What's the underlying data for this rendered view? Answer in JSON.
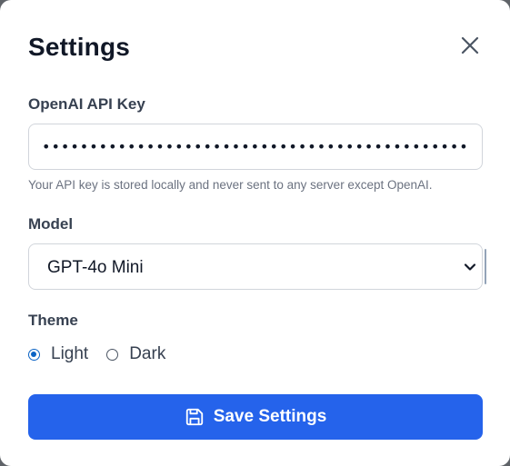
{
  "modal": {
    "title": "Settings",
    "close_icon": "close-icon"
  },
  "api_key": {
    "label": "OpenAI API Key",
    "value": "••••••••••••••••••••••••••••••••••••••••••••••••••••••",
    "help": "Your API key is stored locally and never sent to any server except OpenAI."
  },
  "model": {
    "label": "Model",
    "selected": "GPT-4o Mini",
    "chevron_icon": "chevron-down-icon"
  },
  "theme": {
    "label": "Theme",
    "options": [
      {
        "label": "Light",
        "checked": true
      },
      {
        "label": "Dark",
        "checked": false
      }
    ]
  },
  "save": {
    "label": "Save Settings",
    "icon": "save-icon"
  },
  "colors": {
    "accent": "#2563eb",
    "radio_checked": "#0b63c4",
    "title": "#111827",
    "muted": "#6b7280"
  }
}
